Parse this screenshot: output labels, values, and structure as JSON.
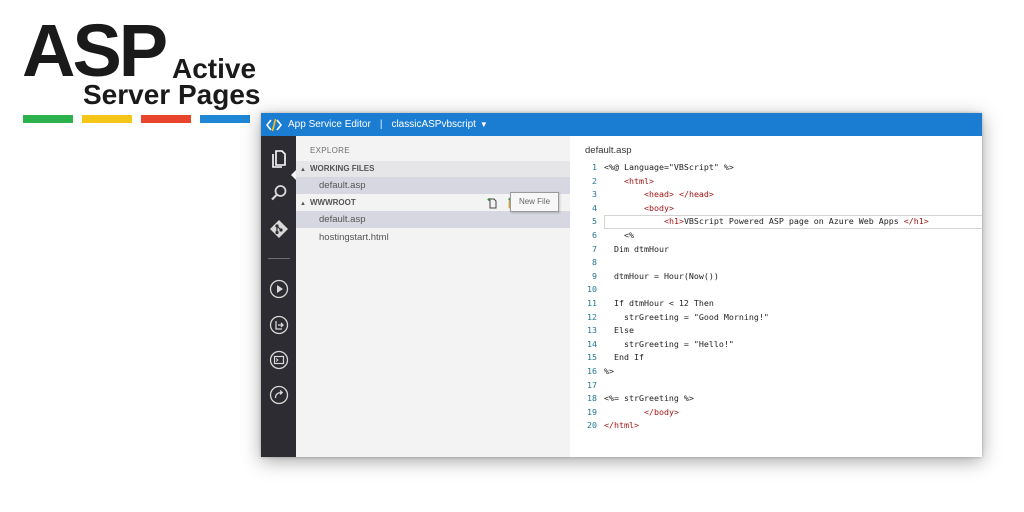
{
  "logo": {
    "mark": "ASP",
    "line1": "Active",
    "line2": "Server Pages",
    "bar_colors": [
      "#2bb24c",
      "#f5c518",
      "#e8452c",
      "#1e88d6"
    ]
  },
  "colors": {
    "titlebar": "#1a7dd1",
    "activity_bar": "#2c2c32",
    "explorer_bg": "#f3f3f3",
    "selected_row": "#d6d7e0",
    "line_number": "#237893",
    "tag": "#a31515"
  },
  "titlebar": {
    "app_name": "App Service Editor",
    "separator": "|",
    "site_name": "classicASPvbscript",
    "dropdown_icon": "caret-down-icon"
  },
  "activity_bar": {
    "icons": [
      "explore-icon",
      "search-icon",
      "git-icon",
      "run-icon",
      "output-icon",
      "console-icon",
      "open-site-icon"
    ]
  },
  "explorer": {
    "title": "EXPLORE",
    "working_files": {
      "label": "WORKING FILES",
      "files": [
        "default.asp"
      ]
    },
    "wwwroot": {
      "label": "WWWROOT",
      "actions": [
        "new-file-icon",
        "new-folder-icon",
        "refresh-icon",
        "more-icon"
      ],
      "files": [
        "default.asp",
        "hostingstart.html"
      ]
    },
    "tooltip": "New File"
  },
  "editor": {
    "tab": "default.asp",
    "lines": [
      {
        "n": "1",
        "text": "<%@ Language=\"VBScript\" %>"
      },
      {
        "n": "2",
        "text": "    <html>"
      },
      {
        "n": "3",
        "text": "        <head> </head>"
      },
      {
        "n": "4",
        "text": "        <body>"
      },
      {
        "n": "5",
        "text": "            <h1>VBScript Powered ASP page on Azure Web Apps </h1>"
      },
      {
        "n": "6",
        "text": "    <%"
      },
      {
        "n": "7",
        "text": "  Dim dtmHour"
      },
      {
        "n": "8",
        "text": ""
      },
      {
        "n": "9",
        "text": "  dtmHour = Hour(Now())"
      },
      {
        "n": "10",
        "text": ""
      },
      {
        "n": "11",
        "text": "  If dtmHour < 12 Then"
      },
      {
        "n": "12",
        "text": "    strGreeting = \"Good Morning!\""
      },
      {
        "n": "13",
        "text": "  Else"
      },
      {
        "n": "14",
        "text": "    strGreeting = \"Hello!\""
      },
      {
        "n": "15",
        "text": "  End If"
      },
      {
        "n": "16",
        "text": "%>"
      },
      {
        "n": "17",
        "text": ""
      },
      {
        "n": "18",
        "text": "<%= strGreeting %>"
      },
      {
        "n": "19",
        "text": "        </body>"
      },
      {
        "n": "20",
        "text": "</html>"
      }
    ]
  }
}
